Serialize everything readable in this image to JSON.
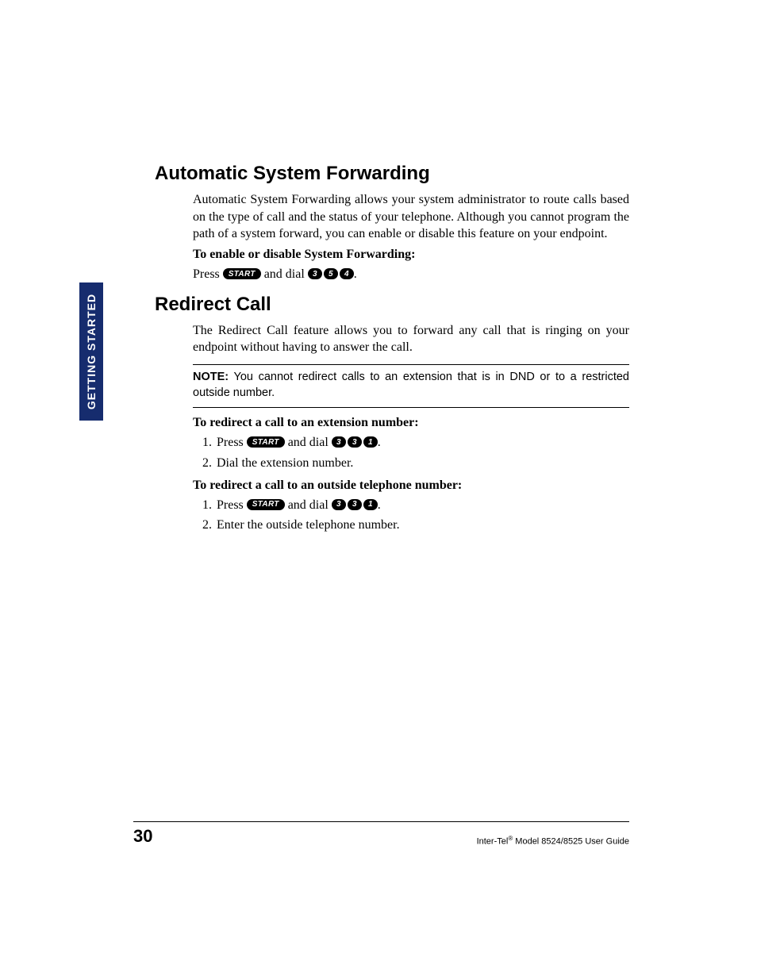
{
  "sidebar": {
    "label": "GETTING STARTED"
  },
  "section1": {
    "heading": "Automatic System Forwarding",
    "para": "Automatic System Forwarding allows your system administrator to route calls based on the type of call and the status of your telephone. Although you cannot program the path of a system forward, you can enable or disable this feature on your endpoint.",
    "lead": "To enable or disable System Forwarding:",
    "press": "Press ",
    "and_dial": " and dial ",
    "start_label": "START",
    "keys": [
      "3",
      "5",
      "4"
    ],
    "period": "."
  },
  "section2": {
    "heading": "Redirect Call",
    "para": "The Redirect Call feature allows you to forward any call that is ringing on your endpoint without having to answer the call.",
    "note_label": "NOTE:",
    "note_text": " You cannot redirect calls to an extension that is in DND or to a restricted outside number.",
    "lead1": "To redirect a call to an extension number:",
    "step1a_press": "Press ",
    "step1a_and_dial": " and dial ",
    "start_label": "START",
    "keys1": [
      "3",
      "3",
      "1"
    ],
    "step1a_period": ".",
    "step1b": "Dial the extension number.",
    "lead2": "To redirect a call to an outside telephone number:",
    "step2a_press": "Press ",
    "step2a_and_dial": " and dial ",
    "keys2": [
      "3",
      "3",
      "1"
    ],
    "step2a_period": ".",
    "step2b": "Enter the outside telephone number."
  },
  "footer": {
    "page": "30",
    "brand": "Inter-Tel",
    "reg": "®",
    "tail": " Model 8524/8525 User Guide"
  }
}
